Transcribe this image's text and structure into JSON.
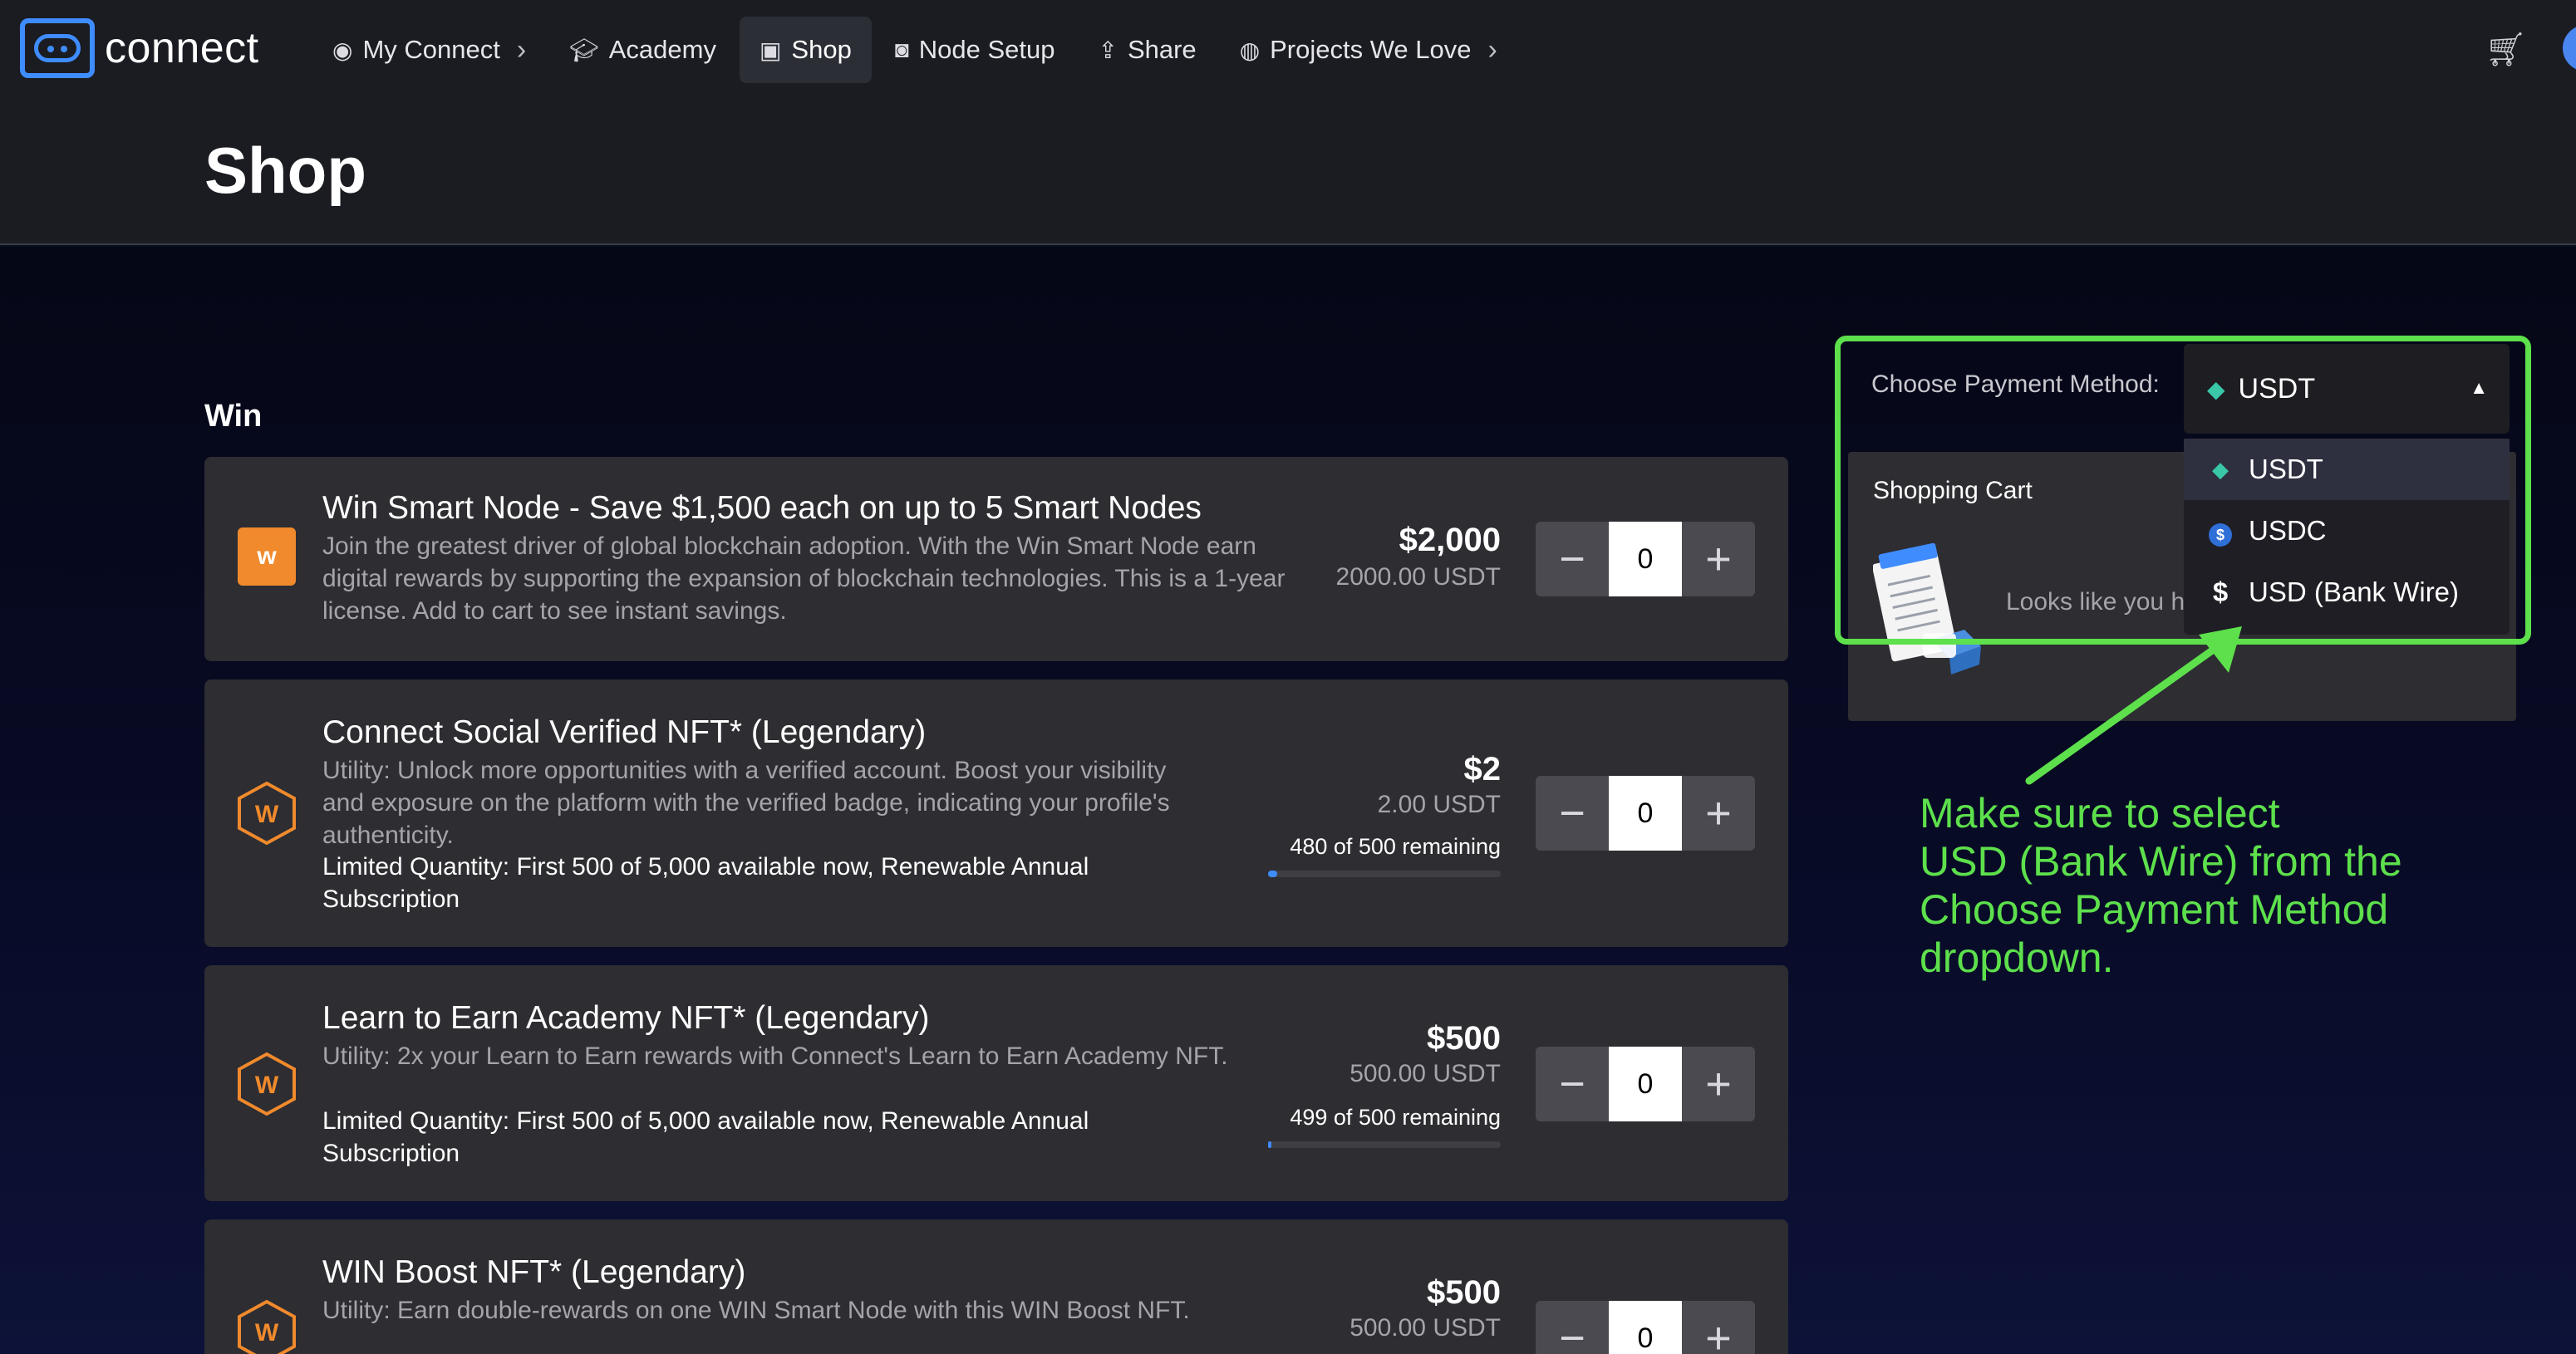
{
  "app": {
    "name": "connect"
  },
  "nav": {
    "items": [
      {
        "label": "My Connect",
        "icon": "eye-icon"
      },
      {
        "label": "Academy",
        "icon": "graduation-cap-icon"
      },
      {
        "label": "Shop",
        "icon": "shopping-bag-icon",
        "active": true
      },
      {
        "label": "Node Setup",
        "icon": "node-icon"
      },
      {
        "label": "Share",
        "icon": "share-icon"
      },
      {
        "label": "Projects We Love",
        "icon": "compass-icon"
      }
    ]
  },
  "page": {
    "title": "Shop",
    "section_title": "Win"
  },
  "products": [
    {
      "title": "Win Smart Node - Save $1,500 each on up to 5 Smart Nodes",
      "description": "Join the greatest driver of global blockchain adoption. With the Win Smart Node earn digital rewards by supporting the expansion of blockchain technologies. This is a 1-year license. Add to cart to see instant savings.",
      "limit": "",
      "price": "$2,000",
      "price_usdt": "2000.00 USDT",
      "remaining": "",
      "quantity": "0"
    },
    {
      "title": "Connect Social Verified NFT* (Legendary)",
      "description": "Utility: Unlock more opportunities with a verified account. Boost your visibility and exposure on the platform with the verified badge, indicating your profile's authenticity.",
      "limit": "Limited Quantity: First 500 of 5,000 available now, Renewable Annual Subscription",
      "price": "$2",
      "price_usdt": "2.00 USDT",
      "remaining": "480 of 500 remaining",
      "remaining_fraction": 0.04,
      "quantity": "0"
    },
    {
      "title": "Learn to Earn Academy NFT* (Legendary)",
      "description": "Utility: 2x your Learn to Earn rewards with Connect's Learn to Earn Academy NFT.",
      "limit": "Limited Quantity: First 500 of 5,000 available now, Renewable Annual Subscription",
      "price": "$500",
      "price_usdt": "500.00 USDT",
      "remaining": "499 of 500 remaining",
      "remaining_fraction": 0.002,
      "quantity": "0"
    },
    {
      "title": "WIN Boost NFT* (Legendary)",
      "description": "Utility: Earn double-rewards on one WIN Smart Node with this WIN Boost NFT.",
      "limit": "",
      "price": "$500",
      "price_usdt": "500.00 USDT",
      "remaining": "",
      "quantity": "0"
    }
  ],
  "payment": {
    "label": "Choose Payment Method:",
    "selected": "USDT",
    "options": [
      {
        "label": "USDT",
        "icon": "tether-gem-icon"
      },
      {
        "label": "USDC",
        "icon": "usdc-coin-icon"
      },
      {
        "label": "USD (Bank Wire)",
        "icon": "dollar-icon"
      }
    ]
  },
  "cart": {
    "title": "Shopping Cart",
    "empty_text": "Looks like you haven't added anything to your cart yet"
  },
  "annotation": {
    "text": "Make sure to select\nUSD (Bank Wire) from the\nChoose Payment Method\ndropdown.",
    "color": "#5de04c"
  },
  "colors": {
    "accent": "#3f8cff",
    "highlight": "#5de04c",
    "brand_orange": "#f08a2c"
  }
}
